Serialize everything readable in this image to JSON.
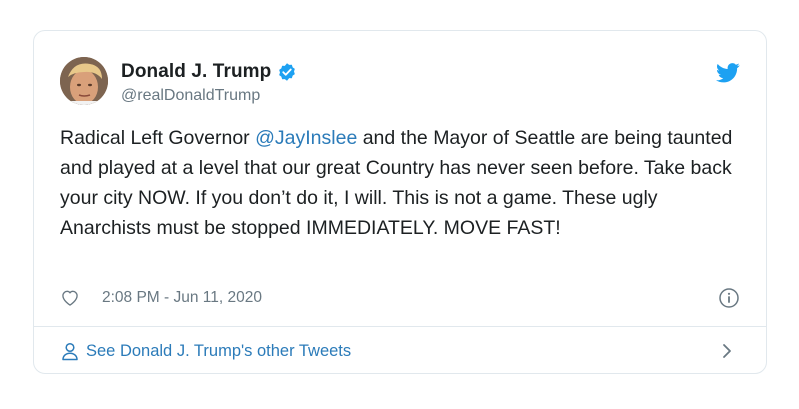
{
  "tweet": {
    "author": {
      "display_name": "Donald J. Trump",
      "handle": "@realDonaldTrump",
      "verified": true
    },
    "text_parts": [
      "Radical Left Governor ",
      "@JayInslee",
      " and the Mayor of Seattle are being taunted and played at a level that our great Country has never seen before. Take back your city NOW. If you don’t do it, I will. This is not a game. These ugly Anarchists must be stopped IMMEDIATELY. MOVE FAST!"
    ],
    "timestamp": "2:08 PM - Jun 11, 2020",
    "footer_link": "See Donald J. Trump's other Tweets"
  },
  "icons": {
    "verified": "verified-badge-icon",
    "twitter": "twitter-bird-icon",
    "like": "heart-icon",
    "info": "info-icon",
    "person": "person-icon",
    "chevron": "chevron-right-icon"
  },
  "colors": {
    "link": "#2b7bb9",
    "twitter_blue": "#1da1f2",
    "muted": "#697882",
    "border": "#e1e8ed",
    "text": "#1c2022"
  }
}
